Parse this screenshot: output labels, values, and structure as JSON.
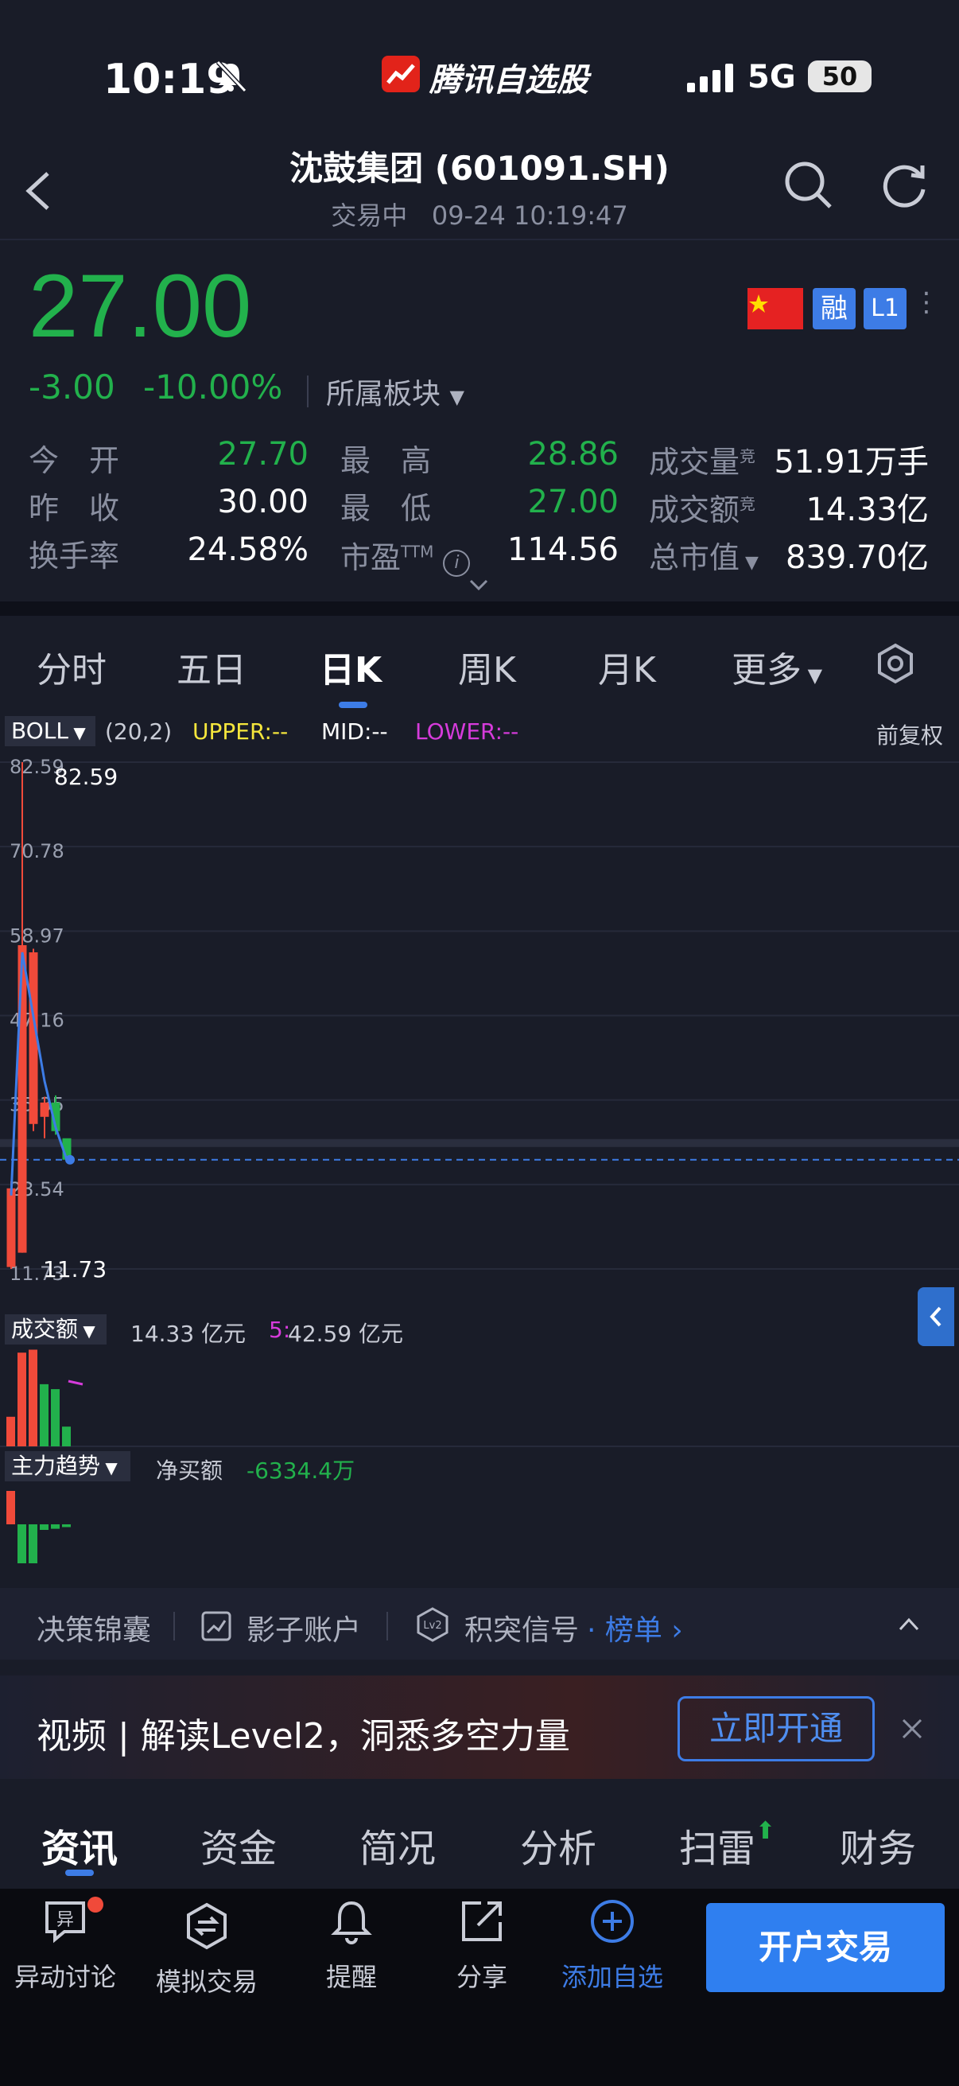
{
  "status_bar": {
    "time": "10:19",
    "app_name": "腾讯自选股",
    "network": "5G",
    "battery": "50"
  },
  "header": {
    "title": "沈鼓集团 (601091.SH)",
    "status": "交易中",
    "datetime": "09-24 10:19:47"
  },
  "quote": {
    "price": "27.00",
    "change": "-3.00",
    "change_pct": "-10.00%",
    "sector": "所属板块",
    "badge_margin": "融",
    "badge_level": "L1",
    "colors": {
      "down": "#22b14c",
      "up": "#f04a3a",
      "accent": "#3d7ce6"
    }
  },
  "stats": {
    "open_label": "今　开",
    "open": "27.70",
    "prev_label": "昨　收",
    "prev": "30.00",
    "turnover_label": "换手率",
    "turnover": "24.58%",
    "high_label": "最　高",
    "high": "28.86",
    "low_label": "最　低",
    "low": "27.00",
    "pe_label": "市盈",
    "pe_sup": "TTM",
    "pe": "114.56",
    "volume_label": "成交量",
    "volume_sup": "竞",
    "volume": "51.91万手",
    "amount_label": "成交额",
    "amount_sup": "竞",
    "amount": "14.33亿",
    "mktcap_label": "总市值",
    "mktcap": "839.70亿"
  },
  "period_tabs": [
    "分时",
    "五日",
    "日K",
    "周K",
    "月K",
    "更多"
  ],
  "active_period": 2,
  "indicator": {
    "name": "BOLL",
    "params": "(20,2)",
    "upper": "UPPER:--",
    "mid": "MID:--",
    "lower": "LOWER:--",
    "adjust": "前复权"
  },
  "chart_data": {
    "type": "candlestick",
    "y_ticks": [
      "82.59",
      "70.78",
      "58.97",
      "47.16",
      "35.35",
      "23.54",
      "11.73"
    ],
    "max_label": "82.59",
    "min_label": "11.73",
    "last_price": 27.0,
    "candles": [
      {
        "open": 12.0,
        "close": 23.0,
        "high": 24.0,
        "low": 11.73,
        "dir": "up"
      },
      {
        "open": 14.0,
        "close": 57.0,
        "high": 82.59,
        "low": 14.0,
        "dir": "up"
      },
      {
        "open": 32.0,
        "close": 56.0,
        "high": 56.5,
        "low": 31.0,
        "dir": "up"
      },
      {
        "open": 33.0,
        "close": 35.0,
        "high": 35.8,
        "low": 30.0,
        "dir": "up"
      },
      {
        "open": 35.0,
        "close": 31.0,
        "high": 36.0,
        "low": 30.5,
        "dir": "down"
      },
      {
        "open": 30.0,
        "close": 27.0,
        "high": 28.86,
        "low": 27.0,
        "dir": "down"
      }
    ],
    "ma_line": [
      22.0,
      56.0,
      47.0,
      38.0,
      31.5,
      27.0
    ]
  },
  "volume_panel": {
    "label": "成交额",
    "value": "14.33 亿元",
    "ma_label": "5:",
    "ma_value": "42.59 亿元",
    "bars": [
      {
        "v": 0.3,
        "dir": "up"
      },
      {
        "v": 0.95,
        "dir": "up"
      },
      {
        "v": 0.98,
        "dir": "up"
      },
      {
        "v": 0.63,
        "dir": "down"
      },
      {
        "v": 0.58,
        "dir": "down"
      },
      {
        "v": 0.2,
        "dir": "down"
      }
    ]
  },
  "flow_panel": {
    "label": "主力趋势",
    "net_label": "净买额",
    "net_value": "-6334.4万",
    "bars": [
      {
        "v": 0.6,
        "dir": "up"
      },
      {
        "v": -0.7,
        "dir": "down"
      },
      {
        "v": -0.7,
        "dir": "down"
      },
      {
        "v": -0.1,
        "dir": "down"
      },
      {
        "v": -0.08,
        "dir": "down"
      },
      {
        "v": -0.05,
        "dir": "down"
      }
    ]
  },
  "toolbar": {
    "item1": "决策锦囊",
    "item2": "影子账户",
    "item3": "积突信号",
    "item3_link": "· 榜单",
    "lv2": "Lv2"
  },
  "promo": {
    "text": "视频 | 解读Level2，洞悉多空力量",
    "button": "立即开通"
  },
  "info_tabs": [
    "资讯",
    "资金",
    "简况",
    "分析",
    "扫雷",
    "财务"
  ],
  "bottom_nav": {
    "discuss": "异动讨论",
    "discuss_icon_char": "异",
    "sim": "模拟交易",
    "alert": "提醒",
    "share": "分享",
    "add": "添加自选",
    "open_account": "开户交易"
  }
}
